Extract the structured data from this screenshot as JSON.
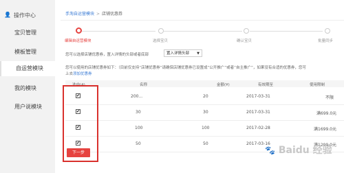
{
  "sidebar": {
    "header": "操作中心",
    "items": [
      {
        "label": "宝贝管理",
        "active": false
      },
      {
        "label": "模板管理",
        "active": false
      },
      {
        "label": "自运营模块",
        "active": true
      },
      {
        "label": "我的模块",
        "active": false
      },
      {
        "label": "用户说模块",
        "active": false
      }
    ]
  },
  "breadcrumb": {
    "link": "手淘自运营模块",
    "separator": ">",
    "current": "店铺优惠券"
  },
  "steps": [
    {
      "label": "编辑自运营模块",
      "active": true
    },
    {
      "label": "选择宝贝",
      "active": false
    },
    {
      "label": "确认宝贝",
      "active": false
    },
    {
      "label": "批量同步",
      "active": false
    }
  ],
  "note1": "您可以选择店铺优惠券，置入详情的头部或者底部",
  "position_select": {
    "value": "置入详情头部"
  },
  "note2": {
    "line1": "您可以使用的店铺优惠券如下：（目前仅支持“店铺优惠券”请确保店铺优惠券已设置成“公开推广”或者“自主推广”，如果没有合适的优惠券，您可",
    "line2_prefix": "上去",
    "line2_link": "添加优惠券"
  },
  "table": {
    "headers": [
      "选中(4)",
      "名称",
      "金额(¥)",
      "有效期至",
      "使用限制"
    ],
    "rows": [
      {
        "checked": "✔",
        "name": "200...",
        "amount": "20",
        "expires": "2017-03-31",
        "limit": "不限"
      },
      {
        "checked": "✔",
        "name": "30",
        "amount": "30",
        "expires": "2017-03-31",
        "limit": "满699.0元"
      },
      {
        "checked": "✔",
        "name": "100",
        "amount": "100",
        "expires": "2017-02-28",
        "limit": "满1699.0元"
      },
      {
        "checked": "✔",
        "name": "50",
        "amount": "50",
        "expires": "2017-03-16",
        "limit": "满1299.0元"
      }
    ]
  },
  "next_button": "下一步",
  "watermark": {
    "text": "Baidu 经验",
    "paw": "🐾"
  },
  "colors": {
    "accent": "#e64340",
    "link": "#3a7bd5",
    "sidebar_bg": "#f2f2f2",
    "highlight_border": "#d9302c"
  }
}
